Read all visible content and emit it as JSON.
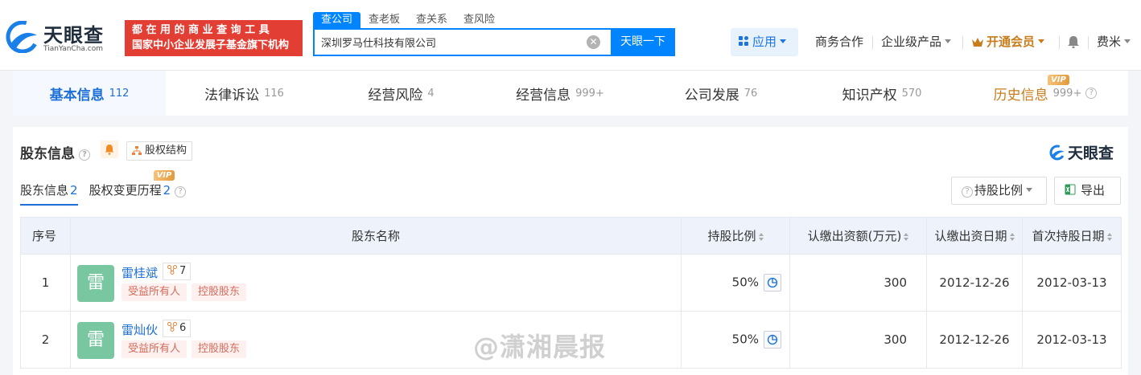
{
  "header": {
    "logo_cn": "天眼查",
    "logo_en": "TianYanCha.com",
    "promo_line1": "都 在 用 的 商 业 查 询 工 具",
    "promo_line2": "国家中小企业发展子基金旗下机构",
    "search_tabs": [
      "查公司",
      "查老板",
      "查关系",
      "查风险"
    ],
    "search_value": "深圳罗马仕科技有限公司",
    "search_button": "天眼一下",
    "nav": {
      "apps": "应用",
      "business": "商务合作",
      "enterprise": "企业级产品",
      "vip": "开通会员",
      "user": "费米"
    }
  },
  "tabs": [
    {
      "label": "基本信息",
      "count": "112"
    },
    {
      "label": "法律诉讼",
      "count": "116"
    },
    {
      "label": "经营风险",
      "count": "4"
    },
    {
      "label": "经营信息",
      "count": "999+"
    },
    {
      "label": "公司发展",
      "count": "76"
    },
    {
      "label": "知识产权",
      "count": "570"
    },
    {
      "label": "历史信息",
      "count": "999+",
      "badge": "VIP"
    }
  ],
  "section": {
    "title": "股东信息",
    "equity_button": "股权结构",
    "brand": "天眼查",
    "subtabs": [
      {
        "label": "股东信息",
        "count": "2"
      },
      {
        "label": "股权变更历程",
        "count": "2",
        "badge": "VIP"
      }
    ],
    "ratio_button": "持股比例",
    "export_button": "导出"
  },
  "table": {
    "headers": [
      "序号",
      "股东名称",
      "持股比例",
      "认缴出资额(万元)",
      "认缴出资日期",
      "首次持股日期"
    ],
    "rows": [
      {
        "index": "1",
        "avatar": "雷",
        "name": "雷桂斌",
        "relations": "7",
        "tags": [
          "受益所有人",
          "控股股东"
        ],
        "ratio": "50%",
        "amount": "300",
        "subscribe_date": "2012-12-26",
        "first_date": "2012-03-13"
      },
      {
        "index": "2",
        "avatar": "雷",
        "name": "雷灿伙",
        "relations": "6",
        "tags": [
          "受益所有人",
          "控股股东"
        ],
        "ratio": "50%",
        "amount": "300",
        "subscribe_date": "2012-12-26",
        "first_date": "2012-03-13"
      }
    ]
  },
  "watermark": "@潇湘晨报",
  "colors": {
    "primary": "#0084ff",
    "promo": "#e23e34",
    "vip": "#c77d1b",
    "avatar": "#79c7a1"
  }
}
